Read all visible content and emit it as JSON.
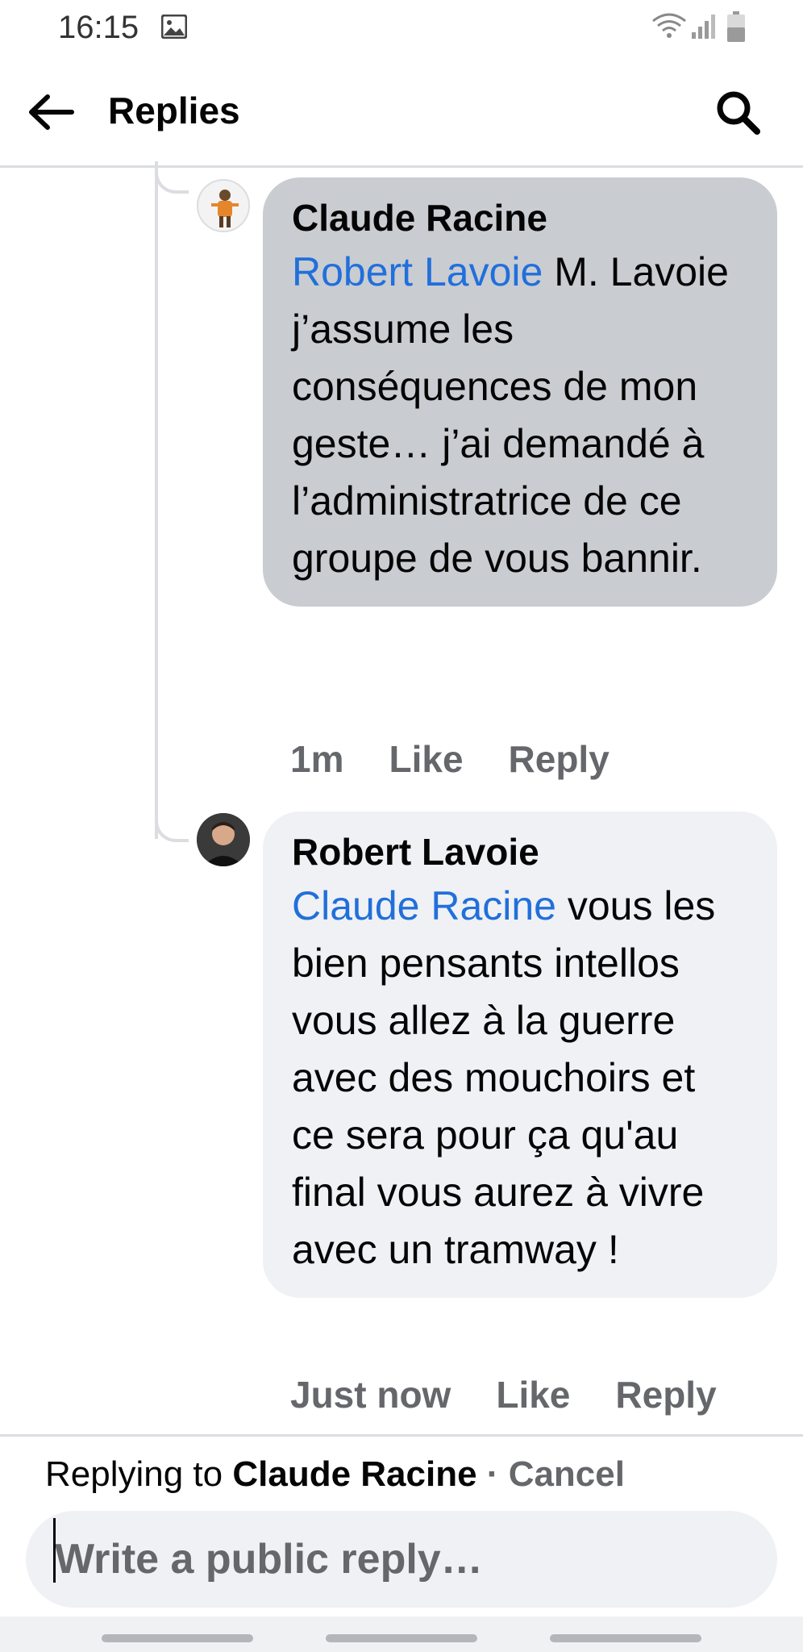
{
  "status_bar": {
    "time": "16:15",
    "icons": [
      "gallery-icon",
      "wifi-icon",
      "signal-icon",
      "battery-icon"
    ]
  },
  "header": {
    "title": "Replies",
    "back_icon": "arrow-left-icon",
    "search_icon": "search-icon"
  },
  "comments": [
    {
      "author": "Claude Racine",
      "mention": "Robert Lavoie",
      "text": " M. Lavoie j’assume les conséquences de mon geste… j’ai demandé à l’administratrice de ce groupe de vous bannir.",
      "time": "1m",
      "like_label": "Like",
      "reply_label": "Reply"
    },
    {
      "author": "Robert Lavoie",
      "mention": "Claude Racine",
      "text": " vous les bien pensants intellos vous allez à la guerre avec des mouchoirs et ce sera pour ça qu'au final vous aurez à vivre avec un tramway !",
      "time": "Just now",
      "like_label": "Like",
      "reply_label": "Reply"
    }
  ],
  "reply_box": {
    "replying_prefix": "Replying to ",
    "replying_name": "Claude Racine",
    "separator": " · ",
    "cancel_label": "Cancel",
    "placeholder": "Write a public reply…"
  },
  "colors": {
    "mention": "#216fdb",
    "bubble_first": "#c9ccd1",
    "bubble_second": "#eff1f4",
    "muted_text": "#65676b"
  }
}
